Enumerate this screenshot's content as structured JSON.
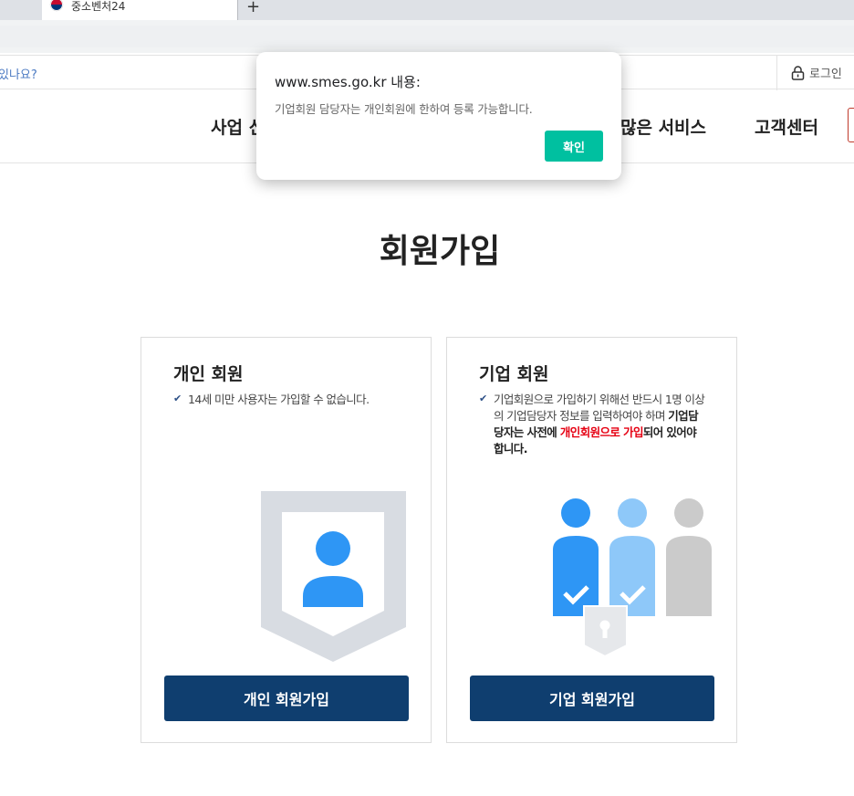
{
  "browser": {
    "tab_title": "중소벤처24",
    "new_tab_label": "+"
  },
  "utility": {
    "search_hint": "있나요?",
    "login_label": "로그인"
  },
  "gnb": {
    "items": [
      "사업 신",
      "많은 서비스",
      "고객센터"
    ]
  },
  "page": {
    "title": "회원가입"
  },
  "cards": {
    "personal": {
      "title": "개인 회원",
      "note": "14세 미만 사용자는 가입할 수 없습니다.",
      "button_label": "개인 회원가입"
    },
    "corporate": {
      "title": "기업 회원",
      "note_part1": "기업회원으로 가입하기 위해선 반드시 1명 이상의 기업담당자 정보를 입력하여야 하며 ",
      "note_part2": "기업담당자는 사전에 ",
      "note_part3": "개인회원으로 가입",
      "note_part4": "되어 있어야 합니다.",
      "button_label": "기업 회원가입"
    }
  },
  "dialog": {
    "title": "www.smes.go.kr 내용:",
    "message": "기업회원 담당자는 개인회원에 한하여 등록 가능합니다.",
    "ok_label": "확인"
  },
  "colors": {
    "button_navy": "#0f3e6f",
    "dialog_ok": "#00c0a0",
    "accent_red": "#e60012",
    "person_blue": "#2e96f5",
    "person_light_blue": "#8ec8f9"
  },
  "icons": [
    "favicon-icon",
    "lock-icon",
    "check-icon",
    "shield-icon",
    "person-icon",
    "padlock-icon"
  ]
}
